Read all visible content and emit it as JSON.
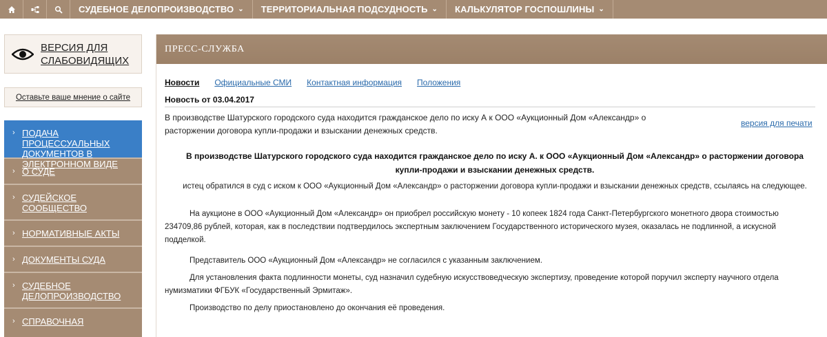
{
  "topbar": {
    "icons": [
      "home-icon",
      "sitemap-icon",
      "search-icon"
    ],
    "menu": [
      {
        "label": "СУДЕБНОЕ ДЕЛОПРОИЗВОДСТВО",
        "chevron": "⌄"
      },
      {
        "label": "ТЕРРИТОРИАЛЬНАЯ ПОДСУДНОСТЬ",
        "chevron": "⌄"
      },
      {
        "label": "КАЛЬКУЛЯТОР ГОСПОШЛИНЫ",
        "chevron": "⌄"
      }
    ]
  },
  "sidebar": {
    "vision_line1": "ВЕРСИЯ ДЛЯ",
    "vision_line2": "СЛАБОВИДЯЩИХ",
    "feedback": "Оставьте ваше мнение о сайте",
    "items": [
      {
        "label": "ПОДАЧА ПРОЦЕССУАЛЬНЫХ ДОКУМЕНТОВ В ЭЛЕКТРОННОМ ВИДЕ"
      },
      {
        "label": "О СУДЕ"
      },
      {
        "label": "СУДЕЙСКОЕ СООБЩЕСТВО"
      },
      {
        "label": "НОРМАТИВНЫЕ АКТЫ"
      },
      {
        "label": "ДОКУМЕНТЫ СУДА"
      },
      {
        "label": "СУДЕБНОЕ ДЕЛОПРОИЗВОДСТВО"
      },
      {
        "label": "СПРАВОЧНАЯ"
      }
    ]
  },
  "main": {
    "header": "ПРЕСС-СЛУЖБА",
    "tabs": [
      {
        "label": "Новости"
      },
      {
        "label": "Официальные СМИ"
      },
      {
        "label": "Контактная информация"
      },
      {
        "label": "Положения"
      }
    ],
    "news_date": "Новость от 03.04.2017",
    "summary": "В производстве Шатурского городского суда находится гражданское дело по иску А к ООО «Аукционный Дом «Александр» о расторжении договора купли-продажи и взыскании денежных средств.",
    "print_link": "версия для печати",
    "article_title": "В производстве Шатурского городского суда находится гражданское дело по иску А. к ООО «Аукционный Дом «Александр» о расторжении договора купли-продажи и взыскании денежных средств.",
    "paragraphs": [
      "истец обратился в суд с иском к ООО «Аукционный Дом «Александр» о расторжении договора купли-продажи и взыскании денежных средств, ссылаясь на следующее.",
      "На аукционе в ООО «Аукционный Дом «Александр» он приобрел российскую монету - 10 копеек 1824 года Санкт-Петербургского монетного двора стоимостью 234709,86 рублей, которая, как в последствии подтвердилось экспертным заключением Государственного исторического музея, оказалась не подлинной, а искусной подделкой.",
      "Представитель ООО «Аукционный Дом «Александр» не согласился с указанным заключением.",
      "Для установления факта подлинности монеты, суд назначил судебную  искусствоведческую экспертизу, проведение которой поручил эксперту научного отдела нумизматики ФГБУК «Государственный Эрмитаж».",
      "Производство по делу приостановлено до окончания её проведения."
    ]
  },
  "colors": {
    "brand": "#a58b73",
    "active_menu": "#3a7fc7",
    "link": "#2a6aab"
  }
}
